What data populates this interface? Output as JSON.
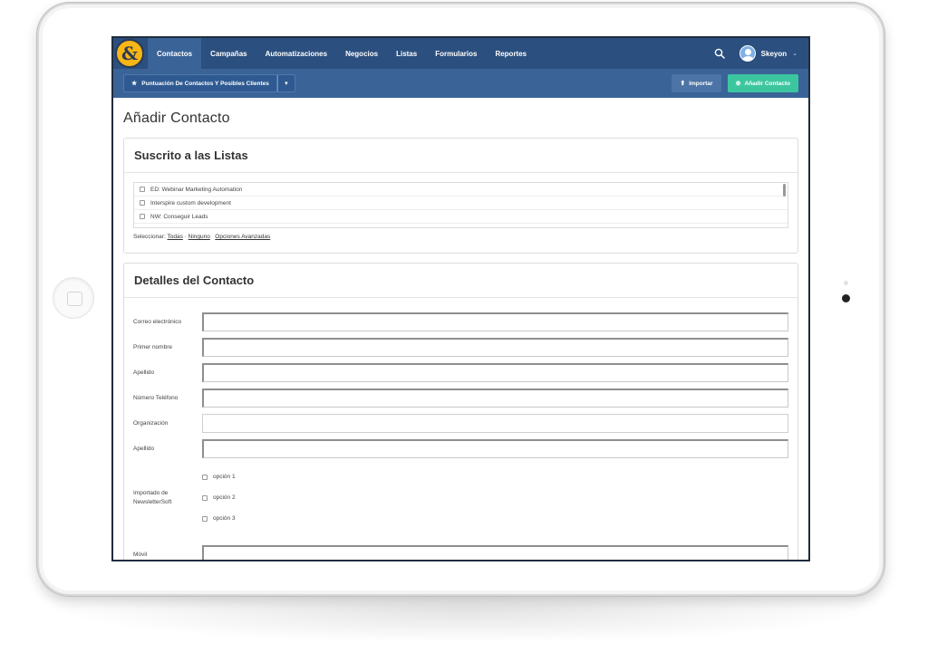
{
  "nav": {
    "logo": "&",
    "items": [
      {
        "label": "Contactos",
        "active": true
      },
      {
        "label": "Campañas",
        "active": false
      },
      {
        "label": "Automatizaciones",
        "active": false
      },
      {
        "label": "Negocios",
        "active": false
      },
      {
        "label": "Listas",
        "active": false
      },
      {
        "label": "Formularios",
        "active": false
      },
      {
        "label": "Reportes",
        "active": false
      }
    ],
    "user_name": "Skeyon",
    "user_caret": "⌄"
  },
  "subbar": {
    "score_label": "Puntuación De Contactos Y Posibles Clientes",
    "score_icon": "★",
    "caret": "▾",
    "import_label": "Importar",
    "import_icon": "⬆",
    "add_label": "Añadir Contacto",
    "add_icon": "⊕"
  },
  "page": {
    "title": "Añadir Contacto"
  },
  "lists_panel": {
    "title": "Suscrito a las Listas",
    "items": [
      "ED: Webinar Marketing Automation",
      "Interspire custom development",
      "NW: Conseguir Leads"
    ],
    "select_prefix": "Seleccionar:",
    "select_all": "Todas",
    "separator": "·",
    "select_none": "Ninguno",
    "advanced": "Opciones Avanzadas"
  },
  "details_panel": {
    "title": "Detalles del Contacto",
    "fields": [
      {
        "label": "Correo electrónico",
        "value": ""
      },
      {
        "label": "Primer nombre",
        "value": ""
      },
      {
        "label": "Apellido",
        "value": ""
      },
      {
        "label": "Número Teléfono",
        "value": ""
      },
      {
        "label": "Organización",
        "value": ""
      },
      {
        "label": "Apellido",
        "value": ""
      }
    ],
    "options_label": "Importado de NewsletterSoft",
    "options": [
      "opción 1",
      "opción 2",
      "opción 3"
    ],
    "mobile_label": "Móvil"
  },
  "colors": {
    "nav_bg": "#2b4f7e",
    "subbar_bg": "#3a6398",
    "logo": "#f7b614",
    "add_button": "#3cc6a0"
  }
}
